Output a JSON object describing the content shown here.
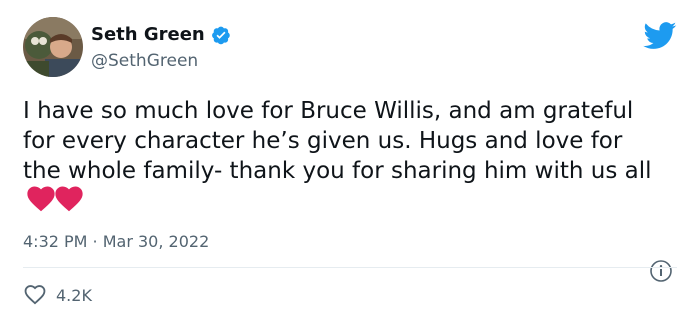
{
  "user": {
    "display_name": "Seth Green",
    "handle": "@SethGreen",
    "verified": true,
    "avatar_icon": "avatar-photo"
  },
  "tweet": {
    "text": "I have so much love for Bruce Willis, and am grateful for every character he’s given us. Hugs and love for the whole family- thank you for sharing him with us all",
    "emoji": [
      "red-heart-icon",
      "red-heart-icon"
    ],
    "timestamp": "4:32 PM · Mar 30, 2022",
    "likes": "4.2K"
  },
  "icons": {
    "brand": "twitter-bird-icon",
    "info": "info-icon",
    "like": "heart-outline-icon"
  },
  "colors": {
    "brand_blue": "#1d9bf0",
    "heart_red": "#e0245e",
    "muted_text": "#536471"
  }
}
